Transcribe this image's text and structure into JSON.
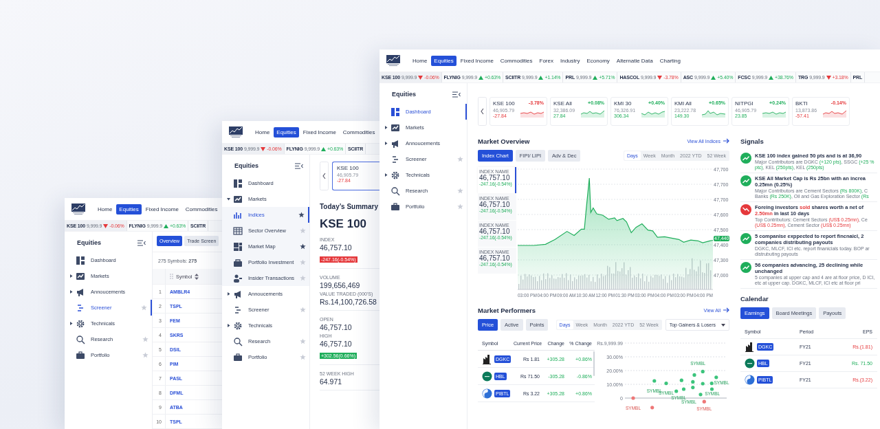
{
  "windows": [
    {
      "kind": "screener",
      "nav": [
        {
          "label": "Home",
          "selected": false
        },
        {
          "label": "Equities",
          "selected": true
        },
        {
          "label": "Fixed Income",
          "selected": false
        },
        {
          "label": "Commodities",
          "selected": false
        }
      ],
      "ticker": [
        {
          "symbol": "KSE 100",
          "price": "9,999.9",
          "change": "-0.06%",
          "rising": false,
          "selected": true
        },
        {
          "symbol": "FLYNIG",
          "price": "9,999.9",
          "change": "+0.63%",
          "rising": true,
          "selected": false
        },
        {
          "symbol": "SCIITR",
          "selected": false
        }
      ],
      "sidebar": {
        "title": "Equities",
        "items": [
          {
            "label": "Dashboard",
            "expandable": false,
            "selected": false
          },
          {
            "label": "Markets",
            "expandable": true,
            "expanded": false,
            "selected": false
          },
          {
            "label": "Annoucements",
            "expandable": true,
            "expanded": false,
            "selected": false
          },
          {
            "label": "Screener",
            "expandable": false,
            "favorite": false,
            "selected": true
          },
          {
            "label": "Technicals",
            "expandable": true,
            "expanded": false,
            "selected": false
          },
          {
            "label": "Research",
            "expandable": false,
            "favorite": false,
            "selected": false
          },
          {
            "label": "Portfolio",
            "expandable": false,
            "favorite": false,
            "selected": false
          }
        ]
      },
      "tabs": [
        {
          "label": "Overview",
          "selected": true
        },
        {
          "label": "Trade Screen",
          "selected": false
        }
      ],
      "summary": "275 Symbols: **275**",
      "table": {
        "columns": [
          "Symbol"
        ],
        "rows": [
          {
            "number": "1",
            "symbol": "AMBLR4"
          },
          {
            "number": "2",
            "symbol": "TSPL"
          },
          {
            "number": "3",
            "symbol": "FEM"
          },
          {
            "number": "4",
            "symbol": "SKRS"
          },
          {
            "number": "5",
            "symbol": "DSIL"
          },
          {
            "number": "6",
            "symbol": "PIM"
          },
          {
            "number": "7",
            "symbol": "PASL"
          },
          {
            "number": "8",
            "symbol": "DFML"
          },
          {
            "number": "9",
            "symbol": "ATBA"
          },
          {
            "number": "10",
            "symbol": "TSPL"
          }
        ]
      }
    },
    {
      "kind": "summary",
      "nav": [
        {
          "label": "Home",
          "selected": false
        },
        {
          "label": "Equities",
          "selected": true
        },
        {
          "label": "Fixed Income",
          "selected": false
        },
        {
          "label": "Commodities",
          "selected": false
        }
      ],
      "ticker": [
        {
          "symbol": "KSE 100",
          "price": "9,999.9",
          "change": "-0.06%",
          "rising": false,
          "selected": true
        },
        {
          "symbol": "FLYNIG",
          "price": "9,999.9",
          "change": "+0.63%",
          "rising": true,
          "selected": false
        },
        {
          "symbol": "SCIITR",
          "selected": false
        }
      ],
      "sidebar": {
        "title": "Equities",
        "items": [
          {
            "label": "Dashboard",
            "expandable": false,
            "selected": false
          },
          {
            "label": "Markets",
            "expandable": true,
            "expanded": true,
            "selected": false,
            "children": [
              {
                "label": "Indices",
                "favorite": true,
                "selected": true
              },
              {
                "label": "Sector Overview",
                "favorite": false,
                "selected": false
              },
              {
                "label": "Market Map",
                "favorite": true,
                "selected": false
              },
              {
                "label": "Portfolio Investment",
                "favorite": false,
                "selected": false
              },
              {
                "label": "Insider Transactions",
                "favorite": false,
                "selected": false
              }
            ]
          },
          {
            "label": "Annoucements",
            "expandable": true,
            "expanded": false,
            "selected": false
          },
          {
            "label": "Screener",
            "expandable": false,
            "favorite": false,
            "selected": false
          },
          {
            "label": "Technicals",
            "expandable": true,
            "expanded": false,
            "selected": false
          },
          {
            "label": "Research",
            "expandable": false,
            "favorite": false,
            "selected": false
          },
          {
            "label": "Portfolio",
            "expandable": false,
            "favorite": false,
            "selected": false
          }
        ]
      },
      "card": {
        "name": "KSE 100",
        "value": "46,905.79",
        "change": "-27.84",
        "rising": false,
        "selected": true
      },
      "title": "Today’s Summary",
      "index": "KSE 100",
      "stats": [
        {
          "label": "INDEX",
          "value": "46,757.10",
          "badge": "-247.16(-0.54%)",
          "rising": false
        },
        {
          "label": "VOLUME",
          "value": "199,656,469"
        },
        {
          "label": "VALUE TRADED (000'S)",
          "value": "Rs.14,100,726.58"
        },
        {
          "label": "OPEN",
          "value": "46,757.10"
        },
        {
          "label": "HIGH",
          "value": "46,757.10",
          "badge": "+302.56(0.66%)",
          "rising": true
        },
        {
          "label": "52 WEEK HIGH",
          "value": "64.971"
        }
      ]
    },
    {
      "kind": "dashboard",
      "nav": [
        {
          "label": "Home",
          "selected": false
        },
        {
          "label": "Equities",
          "selected": true
        },
        {
          "label": "Fixed Income",
          "selected": false
        },
        {
          "label": "Commodities",
          "selected": false
        },
        {
          "label": "Forex",
          "selected": false
        },
        {
          "label": "Industry",
          "selected": false
        },
        {
          "label": "Economy",
          "selected": false
        },
        {
          "label": "Alternatie Data",
          "selected": false
        },
        {
          "label": "Charting",
          "selected": false
        }
      ],
      "ticker": [
        {
          "symbol": "KSE 100",
          "price": "9,999.9",
          "change": "-0.06%",
          "rising": false,
          "selected": true
        },
        {
          "symbol": "FLYNIG",
          "price": "9,999.9",
          "change": "+0.63%",
          "rising": true,
          "selected": false
        },
        {
          "symbol": "SCIITR",
          "price": "9,999.9",
          "change": "+1.14%",
          "rising": true,
          "selected": false
        },
        {
          "symbol": "PRL",
          "price": "9,999.9",
          "change": "+5.71%",
          "rising": true,
          "selected": false
        },
        {
          "symbol": "HASCOL",
          "price": "9,999.9",
          "change": "-3.78%",
          "rising": false,
          "selected": false
        },
        {
          "symbol": "ASC",
          "price": "9,999.9",
          "change": "+5.40%",
          "rising": true,
          "selected": false
        },
        {
          "symbol": "FCSC",
          "price": "9,999.9",
          "change": "+38.76%",
          "rising": true,
          "selected": false
        },
        {
          "symbol": "TRG",
          "price": "9,999.9",
          "change": "+3.18%",
          "rising": false,
          "selected": false
        },
        {
          "symbol": "PRL",
          "selected": false
        }
      ],
      "sidebar": {
        "title": "Equities",
        "items": [
          {
            "label": "Dashboard",
            "expandable": false,
            "selected": true
          },
          {
            "label": "Markets",
            "expandable": true,
            "expanded": false,
            "selected": false
          },
          {
            "label": "Annoucements",
            "expandable": true,
            "expanded": false,
            "selected": false
          },
          {
            "label": "Screener",
            "expandable": false,
            "favorite": false,
            "selected": false
          },
          {
            "label": "Technicals",
            "expandable": true,
            "expanded": false,
            "selected": false
          },
          {
            "label": "Research",
            "expandable": false,
            "favorite": false,
            "selected": false
          },
          {
            "label": "Portfolio",
            "expandable": false,
            "favorite": false,
            "selected": false
          }
        ]
      },
      "index_cards": [
        {
          "name": "KSE 100",
          "value": "46,905.79",
          "change": "-27.84",
          "percent": "-3.78%",
          "rising": false
        },
        {
          "name": "KSE All",
          "value": "32,386.09",
          "change": "27.84",
          "percent": "+0.08%",
          "rising": true
        },
        {
          "name": "KMI 30",
          "value": "76,326.91",
          "change": "306.34",
          "percent": "+0.40%",
          "rising": true
        },
        {
          "name": "KMI All",
          "value": "23,222.78",
          "change": "149.30",
          "percent": "+0.65%",
          "rising": true
        },
        {
          "name": "NITPGI",
          "value": "46,905.79",
          "change": "23.85",
          "percent": "+0.24%",
          "rising": true
        },
        {
          "name": "BKTI",
          "value": "13,873.86",
          "change": "-57.41",
          "percent": "-0.14%",
          "rising": false
        }
      ],
      "market_overview": {
        "title": "Market Overview",
        "link": "View All Indices",
        "tabs": [
          {
            "label": "Index Chart",
            "selected": true
          },
          {
            "label": "FIPI/ LIPI",
            "selected": false
          },
          {
            "label": "Adv & Dec",
            "selected": false
          }
        ],
        "periods": [
          {
            "label": "Days",
            "selected": true
          },
          {
            "label": "Week",
            "selected": false
          },
          {
            "label": "Month",
            "selected": false
          },
          {
            "label": "2022 YTD",
            "selected": false
          },
          {
            "label": "52 Week",
            "selected": false
          }
        ],
        "indices": [
          {
            "label": "INDEX NAME",
            "value": "46,757.10",
            "change": "-247.16(-0.54%)",
            "selected": true
          },
          {
            "label": "INDEX NAME",
            "value": "46,757.10",
            "change": "-247.16(-0.54%)",
            "selected": false
          },
          {
            "label": "INDEX NAME",
            "value": "46,757.10",
            "change": "-247.16(-0.54%)",
            "selected": false
          },
          {
            "label": "INDEX NAME",
            "value": "46,757.10",
            "change": "-247.16(-0.54%)",
            "selected": false
          }
        ],
        "y_labels": [
          "47,700",
          "47,700",
          "47,700",
          "47,600",
          "47,500",
          "47,400",
          "47,300",
          "47,000"
        ],
        "last_price": "47,440",
        "x_labels": [
          "03:00 PM",
          "04:00 PM",
          "09:00 AM",
          "10:30 AM",
          "12:00 PM",
          "01:30 PM",
          "03:00 PM",
          "04:00 PM",
          "03:00 PM",
          "04:00 PM"
        ]
      },
      "signals": {
        "title": "Signals",
        "items": [
          {
            "rising": true,
            "title": [
              {
                "text": "KSE 100 index gained 50 pts and is at 36,90"
              }
            ],
            "detail": [
              {
                "text": "Major Contributors are DGKC "
              },
              {
                "text": "(+120 pts)",
                "emphasis": true
              },
              {
                "text": ", SSGC "
              },
              {
                "text": "(+25 % ptc)",
                "emphasis": true
              },
              {
                "text": ", KEL "
              },
              {
                "text": "(250pts)",
                "emphasis": true
              },
              {
                "text": ", KEL "
              },
              {
                "text": "(250pts)",
                "emphasis": true
              }
            ]
          },
          {
            "rising": true,
            "title": [
              {
                "text": "KSE All Market Cap is Rs 25bn with an increa 0.25mn (0.25%)"
              }
            ],
            "detail": [
              {
                "text": "Major Contributors are Cement Sectors "
              },
              {
                "text": "(Rs 800K)",
                "emphasis": true
              },
              {
                "text": ", C Banks "
              },
              {
                "text": "(Rs 250K)",
                "emphasis": true
              },
              {
                "text": ", Oil and Gas Exploration Sector "
              },
              {
                "text": "(Rs",
                "emphasis": true
              }
            ]
          },
          {
            "rising": false,
            "title": [
              {
                "text": "Foreing investors "
              },
              {
                "text": "sold",
                "emphasis": true
              },
              {
                "text": " shares worth a net of "
              },
              {
                "text": "2.50mn",
                "emphasis": true
              },
              {
                "text": " in last 10 days"
              }
            ],
            "detail": [
              {
                "text": "Top Contributors: Cement Sectors "
              },
              {
                "text": "(US$ 0.25mn)",
                "emphasis": true
              },
              {
                "text": ", Ce "
              },
              {
                "text": "(US$ 0.25mn)",
                "emphasis": true
              },
              {
                "text": ", Cement Sector "
              },
              {
                "text": "(US$ 0.25mn)",
                "emphasis": true
              }
            ]
          },
          {
            "rising": true,
            "title": [
              {
                "text": "5 companise exppected to report fincnaicl, 2 companies distributing payouts"
              }
            ],
            "detail": [
              {
                "text": "DGKC, MLCF, ICI etc. report finanicials today. BOP ar distrubuting payouts"
              }
            ]
          },
          {
            "rising": true,
            "title": [
              {
                "text": "56 companies advancing, 25 declining while unchanged"
              }
            ],
            "detail": [
              {
                "text": "5 companies at upper cap and 4 are at floor price, D ICI, etc at upper cap. DGKC, MLCF, ICI etc at floor pri"
              }
            ]
          }
        ]
      },
      "market_performers": {
        "title": "Market Performers",
        "link": "View All",
        "tabs": [
          {
            "label": "Price",
            "selected": true
          },
          {
            "label": "Active",
            "selected": false
          },
          {
            "label": "Points",
            "selected": false
          }
        ],
        "periods": [
          {
            "label": "Days",
            "selected": true
          },
          {
            "label": "Week",
            "selected": false
          },
          {
            "label": "Month",
            "selected": false
          },
          {
            "label": "2022 YTD",
            "selected": false
          },
          {
            "label": "52 Week",
            "selected": false
          }
        ],
        "dropdown": "Top Gainers & Losers",
        "columns": [
          "Symbol",
          "Current Price",
          "Change",
          "% Change"
        ],
        "rows": [
          {
            "symbol": "DGKC",
            "price": "Rs 1.81",
            "change": "+305.28",
            "percent": "+0.86%",
            "positive": true
          },
          {
            "symbol": "HBL",
            "price": "Rs 71.50",
            "change": "-305.28",
            "percent": "-0.86%",
            "positive": true
          },
          {
            "symbol": "PIBTL",
            "price": "Rs 3.22",
            "change": "+305.28",
            "percent": "+0.86%",
            "positive": true
          }
        ],
        "scatter": {
          "y_labels": [
            "Rs.9,999.99",
            "30.00%",
            "20.00%",
            "10.00%",
            "0"
          ],
          "point_labels": [
            "SYMBL",
            "SYMBL",
            "SYMBL",
            "SYMBL",
            "SYMBL",
            "SYMBL",
            "SYMBL",
            "SYMBL",
            "SYMBL"
          ]
        }
      },
      "calendar": {
        "title": "Calendar",
        "tabs": [
          {
            "label": "Earnings",
            "selected": true
          },
          {
            "label": "Board Meetings",
            "selected": false
          },
          {
            "label": "Payouts",
            "selected": false
          }
        ],
        "columns": [
          "Symbol",
          "Period",
          "EPS"
        ],
        "rows": [
          {
            "symbol": "DGKC",
            "period": "FY21",
            "eps": "Rs.(1.81)",
            "positive": false
          },
          {
            "symbol": "HBL",
            "period": "FY21",
            "eps": "Rs. 71.50",
            "positive": true
          },
          {
            "symbol": "PIBTL",
            "period": "FY21",
            "eps": "Rs.(3.22)",
            "positive": false
          }
        ]
      }
    }
  ]
}
